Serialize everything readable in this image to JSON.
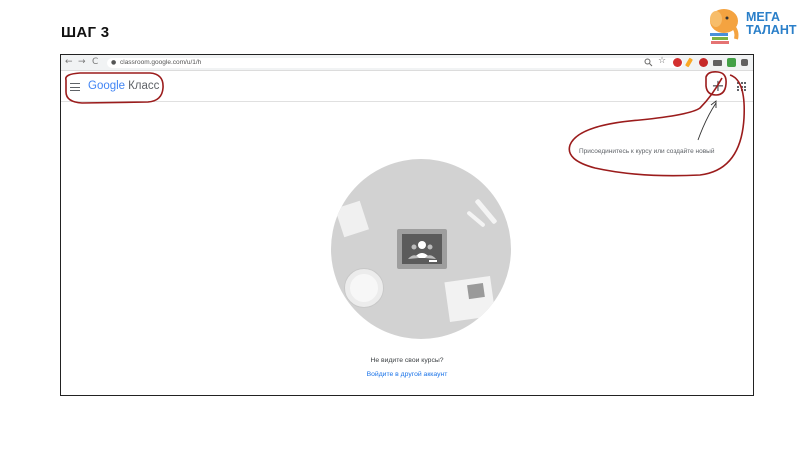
{
  "slide": {
    "title": "ШАГ 3"
  },
  "logo": {
    "line1": "МЕГА",
    "line2": "ТАЛАНТ",
    "icon": "elephant-logo-icon"
  },
  "browser": {
    "back_icon": "←",
    "forward_icon": "→",
    "reload_icon": "C",
    "lock_icon": "🔒",
    "url": "classroom.google.com/u/1/h"
  },
  "header": {
    "brand_google": "Google",
    "brand_product": "Класс",
    "menu_icon": "hamburger-icon",
    "plus_label": "+",
    "apps_icon": "apps-grid-icon"
  },
  "hint": {
    "text": "Присоединитесь к курсу или создайте новый"
  },
  "empty_state": {
    "message": "Не видите свои курсы?",
    "link": "Войдите в другой аккаунт"
  },
  "colors": {
    "link": "#1a73e8",
    "annotation": "#9b1c1c",
    "logo": "#2a7fc9"
  }
}
